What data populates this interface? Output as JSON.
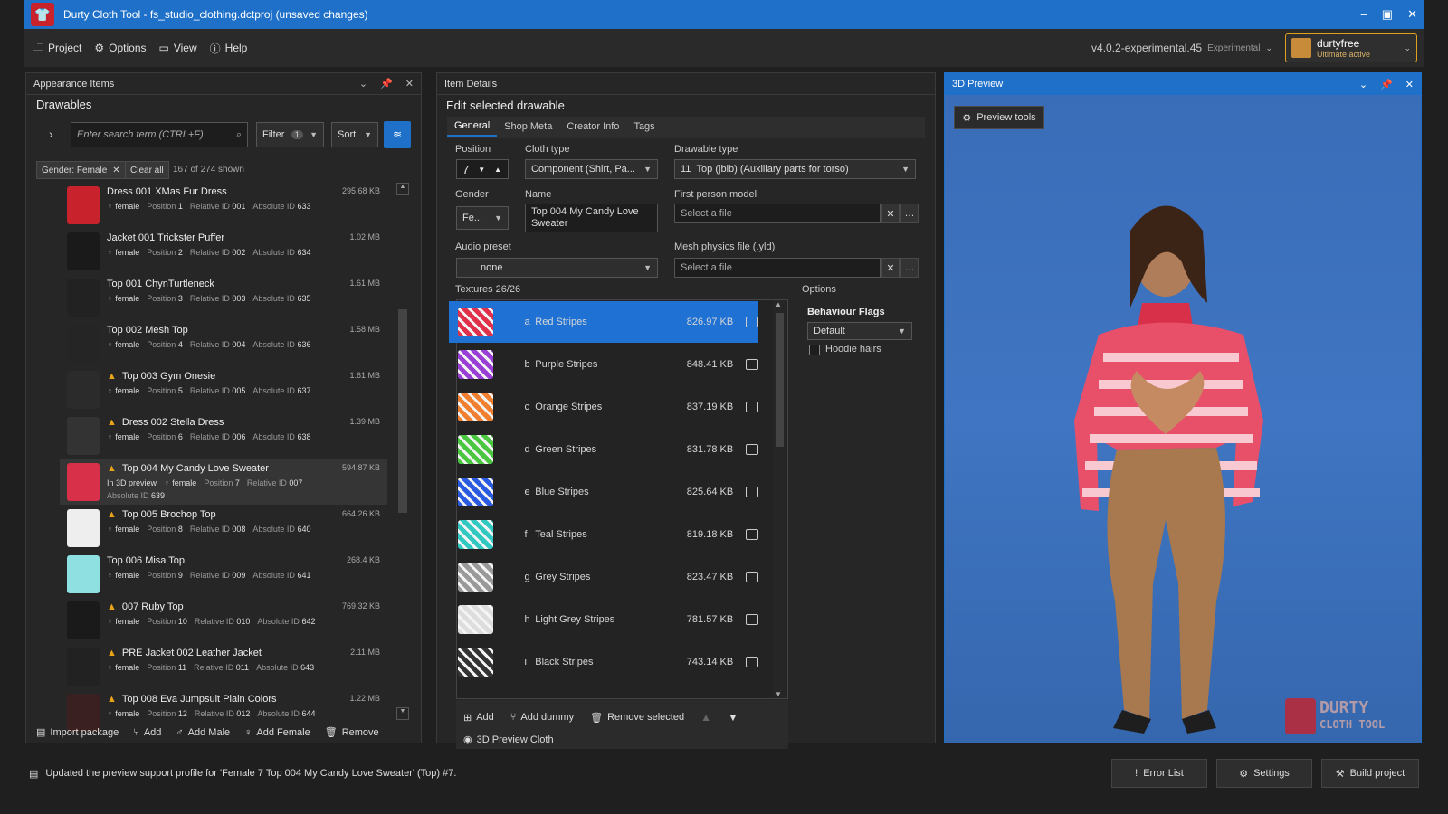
{
  "window": {
    "title": "Durty Cloth Tool - fs_studio_clothing.dctproj (unsaved changes)"
  },
  "menu": {
    "project": "Project",
    "options": "Options",
    "view": "View",
    "help": "Help"
  },
  "version": {
    "label": "v4.0.2-experimental.45",
    "channel": "Experimental"
  },
  "user": {
    "name": "durtyfree",
    "status": "Ultimate active"
  },
  "appearance": {
    "panel_title": "Appearance Items",
    "heading": "Drawables",
    "search_placeholder": "Enter search term (CTRL+F)",
    "filter_label": "Filter",
    "filter_count": "1",
    "sort_label": "Sort",
    "chip": "Gender: Female",
    "clear_all": "Clear all",
    "shown": "167 of 274 shown",
    "items": [
      {
        "name": "Dress 001 XMas Fur Dress",
        "gender": "female",
        "position": "1",
        "rel": "001",
        "abs": "633",
        "size": "295.68 KB",
        "warn": false,
        "color": "#c8232c"
      },
      {
        "name": "Jacket 001 Trickster Puffer",
        "gender": "female",
        "position": "2",
        "rel": "002",
        "abs": "634",
        "size": "1.02 MB",
        "warn": false,
        "color": "#1a1a1a"
      },
      {
        "name": "Top 001 ChynTurtleneck",
        "gender": "female",
        "position": "3",
        "rel": "003",
        "abs": "635",
        "size": "1.61 MB",
        "warn": false,
        "color": "#222"
      },
      {
        "name": "Top 002 Mesh Top",
        "gender": "female",
        "position": "4",
        "rel": "004",
        "abs": "636",
        "size": "1.58 MB",
        "warn": false,
        "color": "#252525"
      },
      {
        "name": "Top 003 Gym Onesie",
        "gender": "female",
        "position": "5",
        "rel": "005",
        "abs": "637",
        "size": "1.61 MB",
        "warn": true,
        "color": "#2b2b2b"
      },
      {
        "name": "Dress 002 Stella Dress",
        "gender": "female",
        "position": "6",
        "rel": "006",
        "abs": "638",
        "size": "1.39 MB",
        "warn": true,
        "color": "#333"
      },
      {
        "name": "Top 004 My Candy Love Sweater",
        "gender": "female",
        "position": "7",
        "rel": "007",
        "abs": "639",
        "size": "594.87 KB",
        "warn": true,
        "color": "#d9304a",
        "in_preview": "In 3D preview"
      },
      {
        "name": "Top 005 Brochop Top",
        "gender": "female",
        "position": "8",
        "rel": "008",
        "abs": "640",
        "size": "664.26 KB",
        "warn": true,
        "color": "#eee"
      },
      {
        "name": "Top 006 Misa Top",
        "gender": "female",
        "position": "9",
        "rel": "009",
        "abs": "641",
        "size": "268.4 KB",
        "warn": false,
        "color": "#8fe0e0"
      },
      {
        "name": "007 Ruby Top",
        "gender": "female",
        "position": "10",
        "rel": "010",
        "abs": "642",
        "size": "769.32 KB",
        "warn": true,
        "color": "#1a1a1a"
      },
      {
        "name": "PRE Jacket 002 Leather Jacket",
        "gender": "female",
        "position": "11",
        "rel": "011",
        "abs": "643",
        "size": "2.11 MB",
        "warn": true,
        "color": "#222"
      },
      {
        "name": "Top 008 Eva Jumpsuit Plain Colors",
        "gender": "female",
        "position": "12",
        "rel": "012",
        "abs": "644",
        "size": "1.22 MB",
        "warn": true,
        "color": "#3a2020"
      }
    ],
    "meta_labels": {
      "position": "Position",
      "relative": "Relative ID",
      "absolute": "Absolute ID"
    },
    "actions": {
      "import": "Import package",
      "add": "Add",
      "add_male": "Add Male",
      "add_female": "Add Female",
      "remove": "Remove"
    }
  },
  "details": {
    "panel_title": "Item Details",
    "heading": "Edit selected drawable",
    "tabs": [
      "General",
      "Shop Meta",
      "Creator Info",
      "Tags"
    ],
    "position_label": "Position",
    "position_value": "7",
    "cloth_type_label": "Cloth type",
    "cloth_type_value": "Component (Shirt, Pa...",
    "drawable_type_label": "Drawable type",
    "drawable_type_num": "11",
    "drawable_type_value": "Top (jbib) (Auxiliary parts for torso)",
    "gender_label": "Gender",
    "gender_value": "Fe...",
    "name_label": "Name",
    "name_value": "Top 004 My Candy Love Sweater",
    "fp_label": "First person model",
    "fp_placeholder": "Select a file",
    "audio_label": "Audio preset",
    "audio_value": "none",
    "mesh_label": "Mesh physics file (.yld)",
    "mesh_placeholder": "Select a file",
    "textures_label": "Textures 26/26",
    "textures": [
      {
        "letter": "a",
        "name": "Red Stripes",
        "size": "826.97 KB",
        "color": "#e0304a"
      },
      {
        "letter": "b",
        "name": "Purple Stripes",
        "size": "848.41 KB",
        "color": "#9a3fd6"
      },
      {
        "letter": "c",
        "name": "Orange Stripes",
        "size": "837.19 KB",
        "color": "#f08030"
      },
      {
        "letter": "d",
        "name": "Green Stripes",
        "size": "831.78 KB",
        "color": "#4ac640"
      },
      {
        "letter": "e",
        "name": "Blue Stripes",
        "size": "825.64 KB",
        "color": "#2a5ae0"
      },
      {
        "letter": "f",
        "name": "Teal Stripes",
        "size": "819.18 KB",
        "color": "#30c8c0"
      },
      {
        "letter": "g",
        "name": "Grey Stripes",
        "size": "823.47 KB",
        "color": "#999"
      },
      {
        "letter": "h",
        "name": "Light Grey Stripes",
        "size": "781.57 KB",
        "color": "#ddd"
      },
      {
        "letter": "i",
        "name": "Black Stripes",
        "size": "743.14 KB",
        "color": "#333"
      }
    ],
    "options_label": "Options",
    "behaviour_label": "Behaviour Flags",
    "behaviour_value": "Default",
    "hoodie_label": "Hoodie hairs",
    "tex_actions": {
      "add": "Add",
      "add_dummy": "Add dummy",
      "remove_selected": "Remove selected",
      "preview": "3D Preview Cloth"
    }
  },
  "preview": {
    "panel_title": "3D Preview",
    "tools": "Preview tools",
    "watermark_line1": "DURTY",
    "watermark_line2": "CLOTH TOOL"
  },
  "status": {
    "message": "Updated the preview support profile for 'Female 7 Top 004 My Candy Love Sweater' (Top) #7.",
    "error_list": "Error List",
    "settings": "Settings",
    "build": "Build project"
  }
}
